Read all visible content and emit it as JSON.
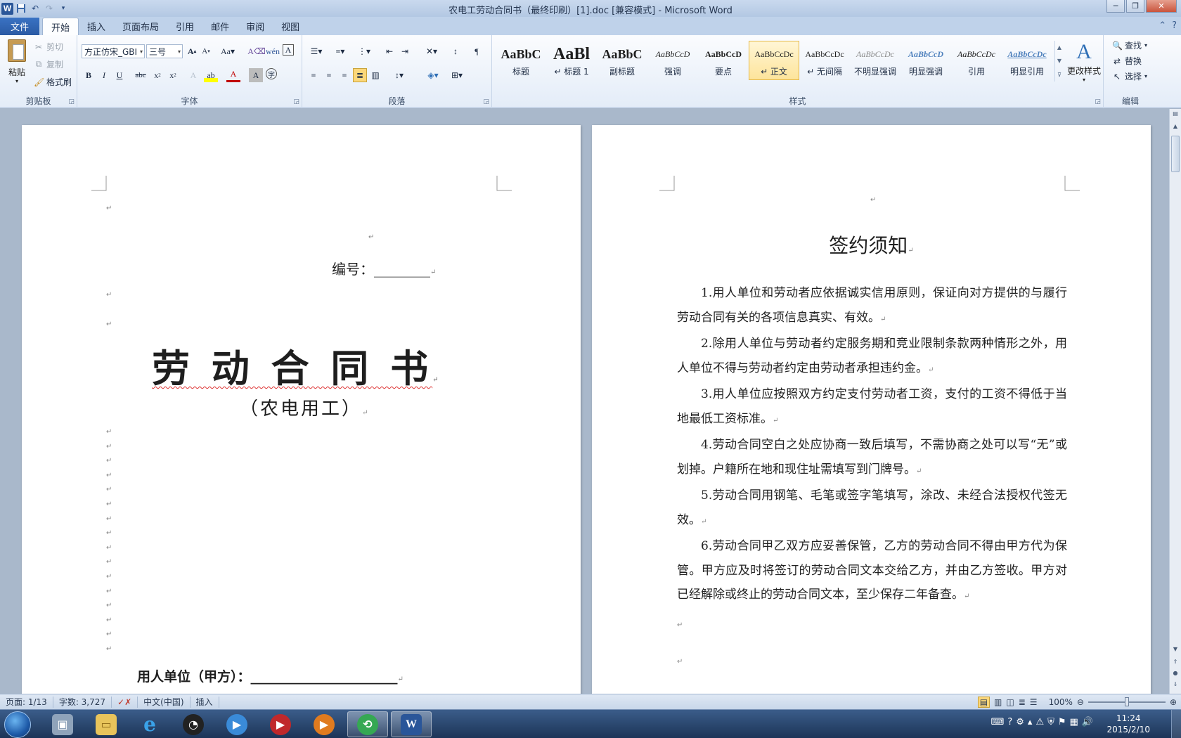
{
  "window": {
    "title": "农电工劳动合同书（最终印刷）[1].doc [兼容模式] - Microsoft Word",
    "app_icon": "W"
  },
  "tabs": [
    "文件",
    "开始",
    "插入",
    "页面布局",
    "引用",
    "邮件",
    "审阅",
    "视图"
  ],
  "active_tab": "开始",
  "clipboard": {
    "paste": "粘贴",
    "cut": "剪切",
    "copy": "复制",
    "format_painter": "格式刷",
    "group_label": "剪贴板"
  },
  "font": {
    "font_name": "方正仿宋_GBI",
    "font_size": "三号",
    "group_label": "字体"
  },
  "paragraph": {
    "group_label": "段落"
  },
  "styles": {
    "group_label": "样式",
    "items": [
      {
        "sample": "AaBbC",
        "name": "标题"
      },
      {
        "sample": "AaBl",
        "name": "↵ 标题 1"
      },
      {
        "sample": "AaBbC",
        "name": "副标题"
      },
      {
        "sample": "AaBbCcD",
        "name": "强调"
      },
      {
        "sample": "AaBbCcD",
        "name": "要点"
      },
      {
        "sample": "AaBbCcDc",
        "name": "↵ 正文"
      },
      {
        "sample": "AaBbCcDc",
        "name": "↵ 无间隔"
      },
      {
        "sample": "AaBbCcDc",
        "name": "不明显强调"
      },
      {
        "sample": "AaBbCcD",
        "name": "明显强调"
      },
      {
        "sample": "AaBbCcDc",
        "name": "引用"
      },
      {
        "sample": "AaBbCcDc",
        "name": "明显引用"
      }
    ],
    "change_styles": "更改样式"
  },
  "editing": {
    "group_label": "编辑",
    "find": "查找",
    "replace": "替换",
    "select": "选择"
  },
  "page1": {
    "number_label": "编号：________",
    "title": "劳 动 合 同 书",
    "subtitle": "（农电用工）",
    "employer_line": "用人单位（甲方）：______________________"
  },
  "page2": {
    "heading": "签约须知",
    "paragraphs": [
      "1.用人单位和劳动者应依据诚实信用原则，保证向对方提供的与履行劳动合同有关的各项信息真实、有效。",
      "2.除用人单位与劳动者约定服务期和竞业限制条款两种情形之外，用人单位不得与劳动者约定由劳动者承担违约金。",
      "3.用人单位应按照双方约定支付劳动者工资，支付的工资不得低于当地最低工资标准。",
      "4.劳动合同空白之处应协商一致后填写，不需协商之处可以写“无”或划掉。户籍所在地和现住址需填写到门牌号。",
      "5.劳动合同用钢笔、毛笔或签字笔填写，涂改、未经合法授权代签无效。",
      "6.劳动合同甲乙双方应妥善保管，乙方的劳动合同不得由甲方代为保管。甲方应及时将签订的劳动合同文本交给乙方，并由乙方签收。甲方对已经解除或终止的劳动合同文本，至少保存二年备查。"
    ]
  },
  "status": {
    "page": "页面: 1/13",
    "words": "字数: 3,727",
    "language": "中文(中国)",
    "mode": "插入",
    "zoom": "100%"
  },
  "clock": {
    "time": "11:24",
    "date": "2015/2/10"
  },
  "colors": {
    "accent": "#2a5699",
    "file_tab": "#2a5aa4",
    "selected_style": "#fde49b"
  }
}
